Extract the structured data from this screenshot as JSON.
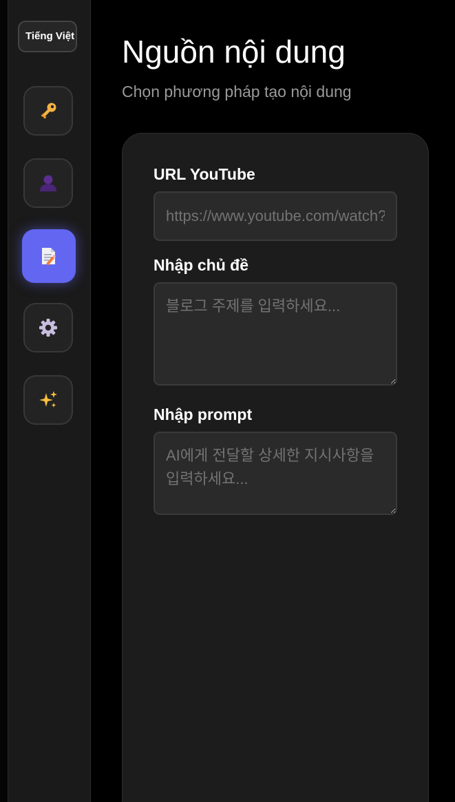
{
  "sidebar": {
    "language_label": "Tiếng Việt",
    "nav_items": [
      {
        "icon": "key-icon"
      },
      {
        "icon": "user-icon"
      },
      {
        "icon": "document-icon",
        "active": true
      },
      {
        "icon": "gear-icon"
      },
      {
        "icon": "sparkles-icon"
      }
    ]
  },
  "main": {
    "title": "Nguồn nội dung",
    "subtitle": "Chọn phương pháp tạo nội dung"
  },
  "form": {
    "youtube_label": "URL YouTube",
    "youtube_placeholder": "https://www.youtube.com/watch?v=...",
    "youtube_value": "",
    "topic_label": "Nhập chủ đề",
    "topic_placeholder": "블로그 주제를 입력하세요...",
    "topic_value": "",
    "prompt_label": "Nhập prompt",
    "prompt_placeholder": "AI에게 전달할 상세한 지시사항을 입력하세요...",
    "prompt_value": ""
  },
  "colors": {
    "accent": "#6366f1",
    "background": "#000000",
    "sidebar": "#1a1a1a",
    "card": "#1c1c1c",
    "input": "#2a2a2a"
  }
}
